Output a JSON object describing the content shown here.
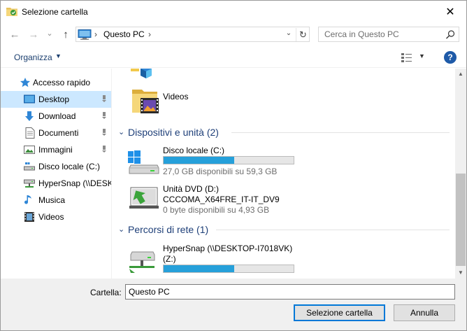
{
  "window": {
    "title": "Selezione cartella",
    "close_glyph": "✕"
  },
  "nav": {
    "back_glyph": "←",
    "forward_glyph": "→",
    "recent_glyph": "⌄",
    "up_glyph": "↑",
    "address": {
      "sep": "›",
      "location": "Questo PC",
      "sep2": "›",
      "dropdown_glyph": "⌄",
      "refresh_glyph": "↻"
    },
    "search": {
      "placeholder": "Cerca in Questo PC"
    }
  },
  "toolbar": {
    "organize_label": "Organizza",
    "organize_caret": "▼",
    "view_caret": "▼",
    "help_label": "?"
  },
  "sidebar": {
    "items": [
      {
        "label": "Accesso rapido",
        "icon": "star-icon"
      },
      {
        "label": "Desktop",
        "icon": "desktop-icon",
        "pinned": true,
        "selected": true
      },
      {
        "label": "Download",
        "icon": "download-icon",
        "pinned": true
      },
      {
        "label": "Documenti",
        "icon": "document-icon",
        "pinned": true
      },
      {
        "label": "Immagini",
        "icon": "pictures-icon",
        "pinned": true
      },
      {
        "label": "Disco locale (C:)",
        "icon": "drive-icon"
      },
      {
        "label": "HyperSnap (\\\\DESK",
        "icon": "network-drive-icon"
      },
      {
        "label": "Musica",
        "icon": "music-icon"
      },
      {
        "label": "Videos",
        "icon": "video-folder-icon"
      }
    ]
  },
  "content": {
    "folders": [
      {
        "name": "Videos",
        "icon": "video-folder-icon"
      }
    ],
    "groups": [
      {
        "chevron": "⌄",
        "title": "Dispositivi e unità (2)",
        "items": [
          {
            "name": "Disco locale (C:)",
            "sub": "27,0 GB disponibili su 59,3 GB",
            "used_fraction": 0.545,
            "icon": "windows-drive-icon"
          },
          {
            "name": "Unità DVD (D:)",
            "name2": "CCCOMA_X64FRE_IT-IT_DV9",
            "sub": "0 byte disponibili su 4,93 GB",
            "icon": "dvd-drive-icon"
          }
        ]
      },
      {
        "chevron": "⌄",
        "title": "Percorsi di rete (1)",
        "items": [
          {
            "name": "HyperSnap (\\\\DESKTOP-I7018VK)",
            "name2": "(Z:)",
            "used_fraction": 0.545,
            "icon": "network-drive-icon"
          }
        ]
      }
    ]
  },
  "scrollbar": {
    "up_glyph": "▲",
    "down_glyph": "▼"
  },
  "footer": {
    "folder_label": "Cartella:",
    "folder_value": "Questo PC",
    "select_button": "Selezione cartella",
    "cancel_button": "Annulla"
  }
}
